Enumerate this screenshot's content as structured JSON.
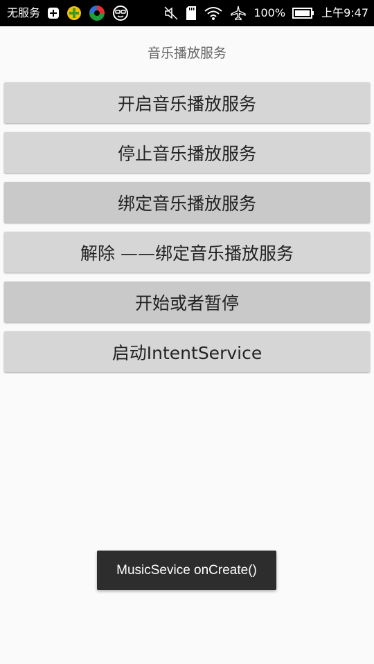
{
  "status_bar": {
    "carrier": "无服务",
    "battery": "100%",
    "time": "上午9:47"
  },
  "title": "音乐播放服务",
  "buttons": [
    {
      "label": "开启音乐播放服务"
    },
    {
      "label": "停止音乐播放服务"
    },
    {
      "label": "绑定音乐播放服务"
    },
    {
      "label": "解除 ——绑定音乐播放服务"
    },
    {
      "label": "开始或者暂停"
    },
    {
      "label": "启动IntentService"
    }
  ],
  "toast": "MusicSevice onCreate()"
}
